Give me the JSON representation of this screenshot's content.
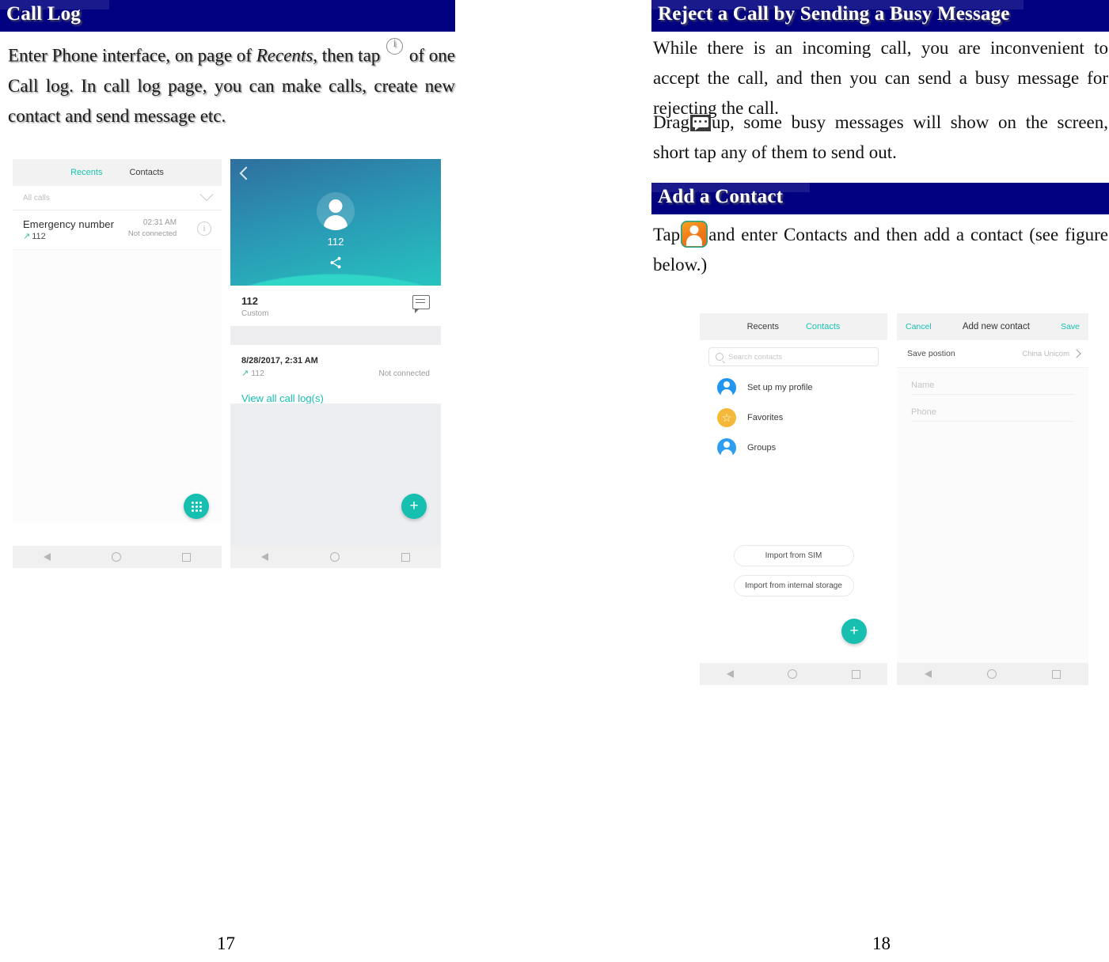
{
  "document": {
    "left_page": {
      "number": "17",
      "heading": "Call Log",
      "paragraph_prefix": "Enter Phone interface, on page of ",
      "paragraph_italic": "Recents",
      "paragraph_mid": ", then tap ",
      "paragraph_suffix": " of one Call log. In call log page, you can make calls, create new contact and send message etc.",
      "info_icon": "info-circle-icon"
    },
    "right_page": {
      "number": "18",
      "section1": {
        "heading": "Reject a Call by Sending a Busy Message",
        "paragraph1": "While there is an incoming call, you are inconvenient to accept the call, and then you can send a busy message for rejecting the call.",
        "paragraph2_prefix": "Drag",
        "paragraph2_suffix": "up, some busy messages will show on the screen, short tap any of them to send out.",
        "bubble_icon": "busy-message-bubble-icon"
      },
      "section2": {
        "heading": "Add a Contact",
        "paragraph_prefix": "Tap",
        "paragraph_suffix": "and enter Contacts and then add a contact (see figure below.)",
        "contacts_icon": "contacts-app-icon"
      }
    }
  },
  "figures": {
    "call_log_list": {
      "tabs": [
        {
          "label": "Recents",
          "active": true
        },
        {
          "label": "Contacts",
          "active": false
        }
      ],
      "filter": {
        "label": "All calls",
        "icon": "chevron-down-icon"
      },
      "entry": {
        "name": "Emergency number",
        "number": "112",
        "direction_icon": "outgoing-call-arrow-icon",
        "time": "02:31 AM",
        "status": "Not connected",
        "info_icon": "info-circle-icon"
      },
      "fab": {
        "icon": "dialpad-icon"
      },
      "navbar": [
        "back-icon",
        "home-icon",
        "recents-icon"
      ]
    },
    "call_detail": {
      "back_icon": "back-chevron-icon",
      "avatar_icon": "person-avatar-icon",
      "hero_name": "112",
      "share_icon": "share-icon",
      "number": "112",
      "number_label": "Custom",
      "message_icon": "message-icon",
      "log": {
        "date": "8/28/2017, 2:31 AM",
        "number": "112",
        "direction_icon": "outgoing-call-arrow-icon",
        "status": "Not connected"
      },
      "view_all": "View all call log(s)",
      "fab": {
        "icon": "add-plus-icon"
      },
      "navbar": [
        "back-icon",
        "home-icon",
        "recents-icon"
      ]
    },
    "contacts_list": {
      "tabs": [
        {
          "label": "Recents",
          "active": false
        },
        {
          "label": "Contacts",
          "active": true
        }
      ],
      "search": {
        "placeholder": "Search contacts",
        "icon": "search-icon"
      },
      "items": [
        {
          "label": "Set up my profile",
          "icon": "person-avatar-icon",
          "color": "#2196ef"
        },
        {
          "label": "Favorites",
          "icon": "star-icon",
          "color": "#f5b93a"
        },
        {
          "label": "Groups",
          "icon": "group-icon",
          "color": "#2f9ef0"
        }
      ],
      "import_buttons": [
        "Import from SIM",
        "Import from internal storage"
      ],
      "fab": {
        "icon": "add-plus-icon"
      },
      "navbar": [
        "back-icon",
        "home-icon",
        "recents-icon"
      ]
    },
    "add_new_contact": {
      "cancel": "Cancel",
      "title": "Add new contact",
      "save": "Save",
      "save_position": {
        "label": "Save postion",
        "value": "China Unicom",
        "icon": "chevron-right-icon"
      },
      "fields": [
        {
          "placeholder": "Name"
        },
        {
          "placeholder": "Phone"
        }
      ],
      "navbar": [
        "back-icon",
        "home-icon",
        "recents-icon"
      ]
    }
  },
  "colors": {
    "heading_bar": "#000080",
    "accent_teal": "#16bfb0",
    "avatar_blue": "#2196ef",
    "star_amber": "#f5b93a"
  }
}
